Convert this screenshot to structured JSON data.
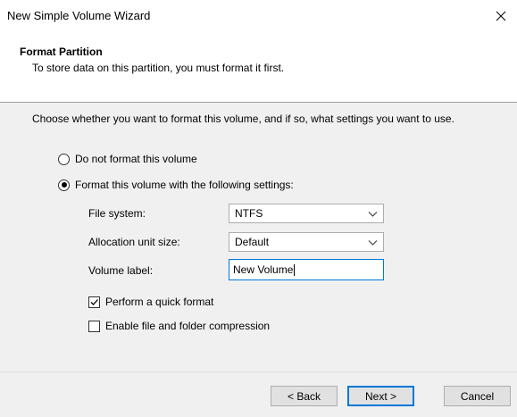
{
  "window": {
    "title": "New Simple Volume Wizard"
  },
  "header": {
    "title": "Format Partition",
    "subtitle": "To store data on this partition, you must format it first."
  },
  "content": {
    "intro": "Choose whether you want to format this volume, and if so, what settings you want to use.",
    "radio_options": [
      {
        "label": "Do not format this volume",
        "checked": false
      },
      {
        "label": "Format this volume with the following settings:",
        "checked": true
      }
    ],
    "fields": {
      "file_system": {
        "label": "File system:",
        "value": "NTFS"
      },
      "allocation_unit": {
        "label": "Allocation unit size:",
        "value": "Default"
      },
      "volume_label": {
        "label": "Volume label:",
        "value": "New Volume"
      }
    },
    "checkboxes": [
      {
        "label": "Perform a quick format",
        "checked": true
      },
      {
        "label": "Enable file and folder compression",
        "checked": false
      }
    ]
  },
  "buttons": {
    "back": "< Back",
    "next": "Next >",
    "cancel": "Cancel"
  },
  "icons": {
    "close": "close-icon",
    "dropdown": "chevron-down-icon",
    "check": "checkmark-icon"
  },
  "colors": {
    "accent": "#0078d7",
    "dialog_bg": "#f0f0f0",
    "header_bg": "#ffffff"
  }
}
